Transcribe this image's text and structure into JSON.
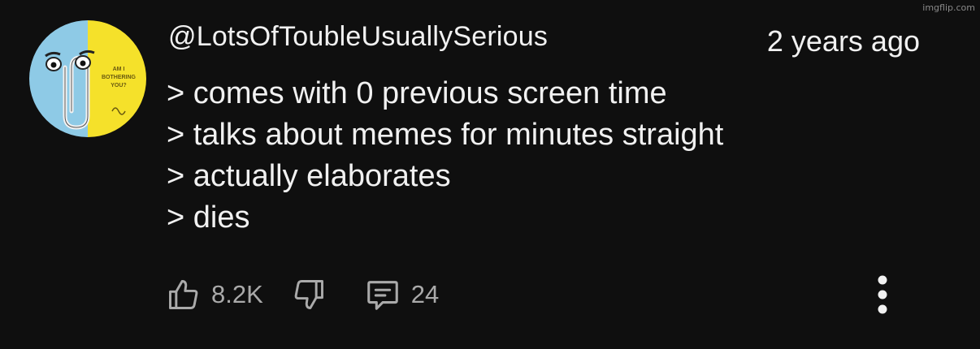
{
  "watermark": "imgflip.com",
  "comment": {
    "author": "@LotsOfToubleUsuallySerious",
    "time": "2 years ago",
    "avatar": {
      "icon": "clippy-icon",
      "text_line1": "AM I",
      "text_line2": "BOTHERING",
      "text_line3": "YOU?",
      "colors": {
        "left": "#8ecae6",
        "right": "#f5e12a"
      }
    },
    "lines": [
      "> comes with 0 previous screen time",
      "> talks about memes for minutes straight",
      "> actually elaborates",
      "> dies"
    ]
  },
  "actions": {
    "like": {
      "icon": "thumbs-up-icon",
      "count": "8.2K"
    },
    "dislike": {
      "icon": "thumbs-down-icon"
    },
    "reply": {
      "icon": "reply-comment-icon",
      "count": "24"
    },
    "more": {
      "icon": "more-vertical-icon"
    }
  },
  "colors": {
    "background": "#0f0f0f",
    "text": "#f1f1f1",
    "secondary": "#aaaaaa"
  }
}
